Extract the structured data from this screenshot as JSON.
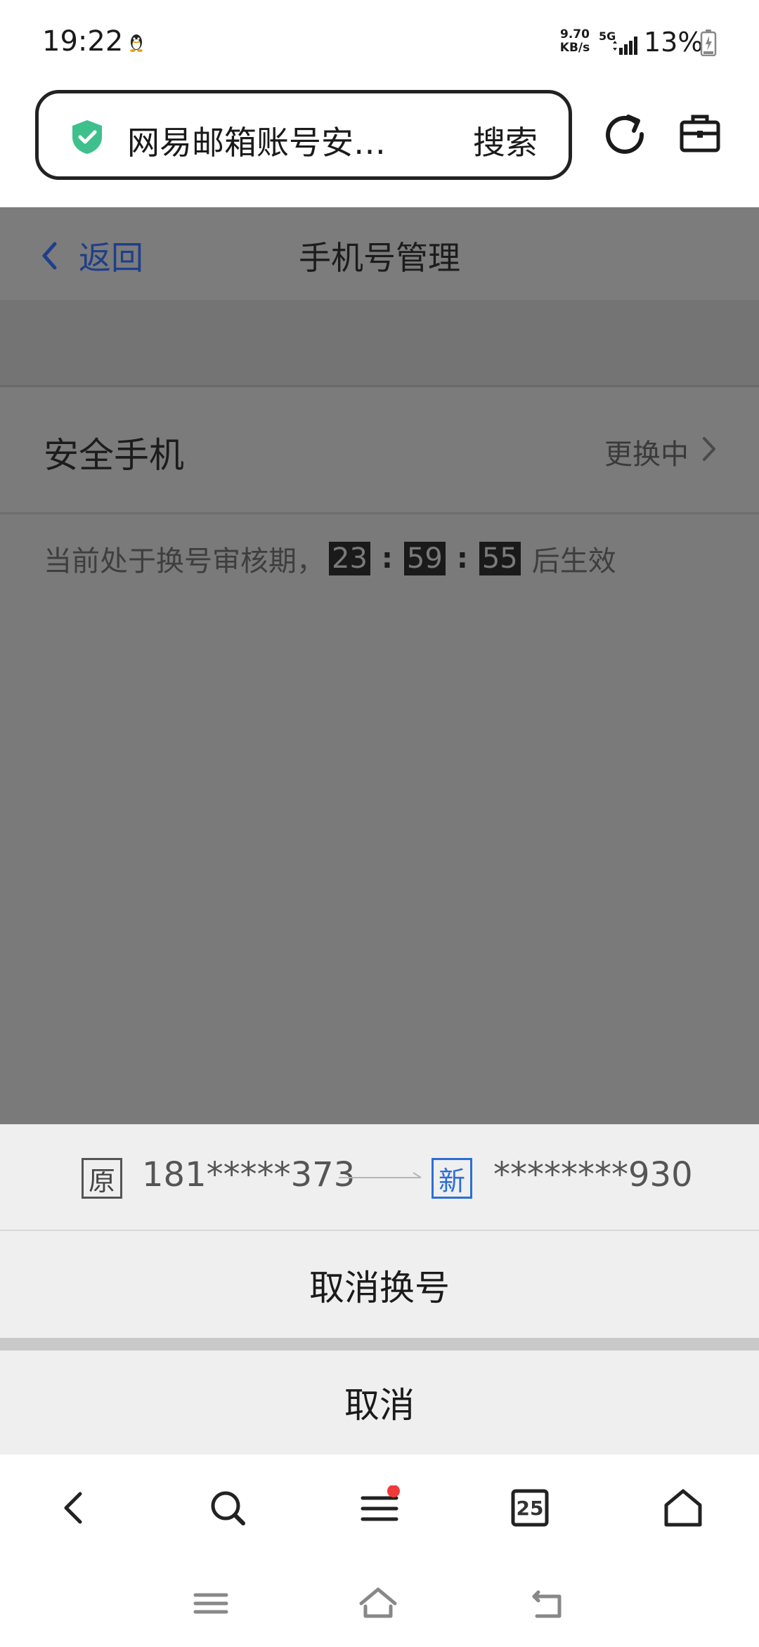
{
  "status_bar": {
    "time": "19:22",
    "speed_value": "9.70",
    "speed_unit": "KB/s",
    "network": "5G",
    "battery": "13%"
  },
  "browser": {
    "address_title": "网易邮箱账号安…",
    "search_label": "搜索",
    "icons": {
      "security": "shield-check-icon",
      "refresh": "refresh-icon",
      "toolbox": "toolbox-icon"
    }
  },
  "page": {
    "back_label": "返回",
    "title": "手机号管理",
    "phone_row": {
      "label": "安全手机",
      "status": "更换中"
    },
    "review": {
      "prefix": "当前处于换号审核期，",
      "hours": "23",
      "minutes": "59",
      "seconds": "55",
      "separator": ":",
      "suffix": "后生效"
    }
  },
  "sheet": {
    "old_tag": "原",
    "old_number": "181*****373",
    "new_tag": "新",
    "new_number": "********930",
    "cancel_swap_label": "取消换号",
    "cancel_label": "取消"
  },
  "toolbar": {
    "tabs_count": "25",
    "menu_has_notification": true
  },
  "colors": {
    "link_blue": "#1f3f8a",
    "new_tag_blue": "#2b6fd6",
    "shield_green": "#3ec08d",
    "notification_red": "#f03a3a",
    "overlay_gray": "#7a7a7a"
  }
}
